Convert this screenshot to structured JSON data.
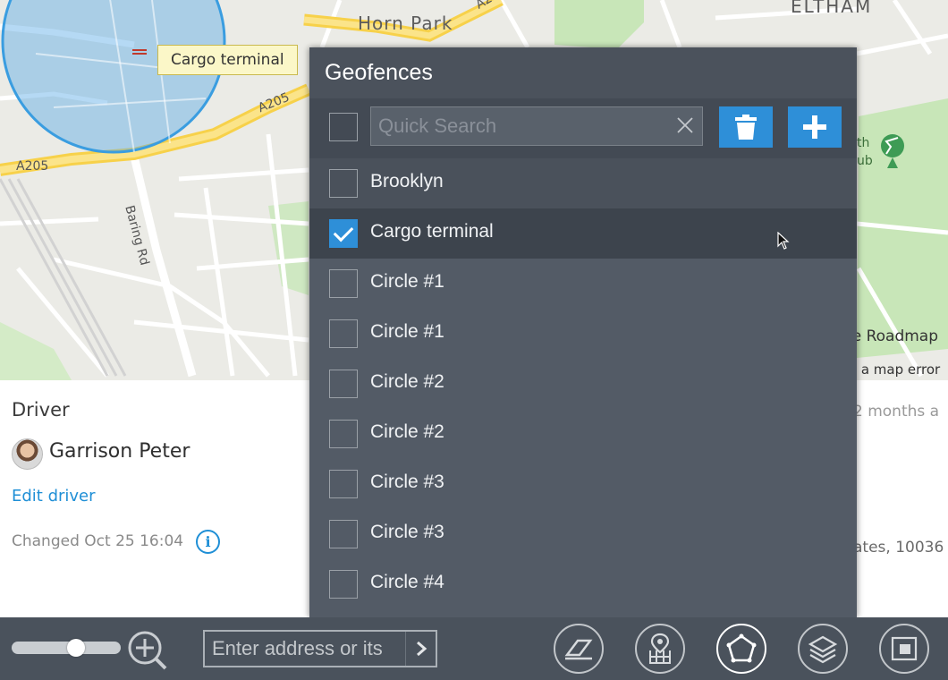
{
  "map": {
    "places": [
      "Horn Park",
      "ELTHAM"
    ],
    "roads": [
      "A205",
      "A205",
      "A2",
      "Baring Rd"
    ],
    "tooltip": "Cargo terminal",
    "attribution_right": "le Roadmap",
    "attribution_error": "rt a map error",
    "poi_partial": "th",
    "poi_partial2": "ub"
  },
  "driver": {
    "title": "Driver",
    "name": "Garrison Peter",
    "edit_label": "Edit driver",
    "changed_text": "Changed Oct 25 16:04",
    "info_icon_glyph": "i"
  },
  "right_panel": {
    "time_text": "2 months a",
    "address_text": "ates, 10036"
  },
  "geofences": {
    "title": "Geofences",
    "search_placeholder": "Quick Search",
    "search_value": "",
    "items": [
      {
        "label": "Brooklyn",
        "checked": false
      },
      {
        "label": "Cargo terminal",
        "checked": true
      },
      {
        "label": "Circle #1",
        "checked": false
      },
      {
        "label": "Circle #1",
        "checked": false
      },
      {
        "label": "Circle #2",
        "checked": false
      },
      {
        "label": "Circle #2",
        "checked": false
      },
      {
        "label": "Circle #3",
        "checked": false
      },
      {
        "label": "Circle #3",
        "checked": false
      },
      {
        "label": "Circle #4",
        "checked": false
      }
    ]
  },
  "bottom": {
    "zoom_level_fraction": 0.61,
    "address_placeholder": "Enter address or its",
    "tools": [
      "eraser-icon",
      "map-pin-grid-icon",
      "polygon-geofence-icon",
      "layers-icon",
      "picture-in-picture-icon"
    ],
    "active_tool": "polygon-geofence-icon"
  },
  "colors": {
    "accent": "#2e8fd8",
    "panel_bg": "#535b66",
    "toolbar_bg": "#4a525c",
    "geofence_circle": "#4da6e8"
  }
}
